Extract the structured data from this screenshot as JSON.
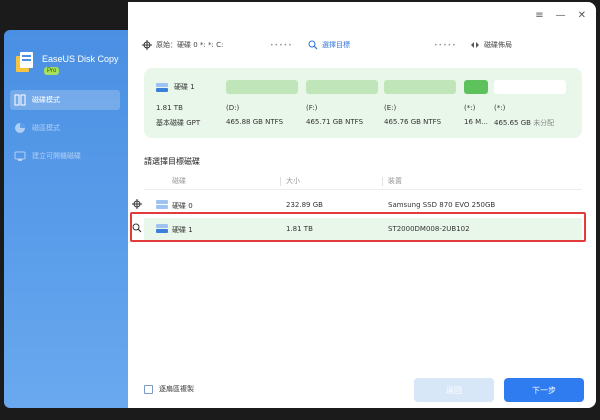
{
  "app": {
    "name": "EaseUS Disk Copy",
    "badge": "Pro"
  },
  "sidebar": {
    "items": [
      {
        "label": "磁碟模式",
        "active": true
      },
      {
        "label": "磁區模式",
        "active": false
      },
      {
        "label": "建立可開機磁碟",
        "active": false
      }
    ]
  },
  "titlebar": {
    "menu_icon": "menu-icon",
    "minimize_icon": "minimize-icon",
    "close_icon": "close-icon"
  },
  "steps": {
    "source": "原始：硬碟 0 *: *: C:",
    "target": "選擇目標",
    "layout": "磁碟佈局",
    "dots1": "•••••",
    "dots2": "•••••"
  },
  "disk_card": {
    "name": "硬碟 1",
    "size": "1.81 TB",
    "type": "基本磁碟 GPT",
    "partitions": [
      {
        "label": "(D:)",
        "size": "465.88 GB NTFS"
      },
      {
        "label": "(F:)",
        "size": "465.71 GB NTFS"
      },
      {
        "label": "(E:)",
        "size": "465.76 GB NTFS"
      },
      {
        "label": "(*:)",
        "size": "16 M..."
      },
      {
        "label": "(*:)",
        "size": "465.65 GB",
        "extra": "未分配"
      }
    ]
  },
  "section_title": "請選擇目標磁碟",
  "table": {
    "headers": [
      "磁碟",
      "大小",
      "裝置"
    ],
    "rows": [
      {
        "disk": "硬碟 0",
        "size": "232.89 GB",
        "device": "Samsung SSD 870 EVO 250GB"
      },
      {
        "disk": "硬碟 1",
        "size": "1.81 TB",
        "device": "ST2000DM008-2UB102"
      }
    ]
  },
  "footer": {
    "sector_copy": "逐扇區複製",
    "back": "返回",
    "next": "下一步"
  },
  "colors": {
    "accent": "#2f7cf0",
    "sidebar": "#4a8fe3",
    "card_bg": "#e9f7ea",
    "partition": "#bfe5b9",
    "partition_small": "#5ec25c",
    "selection_outline": "#e23b3b"
  }
}
